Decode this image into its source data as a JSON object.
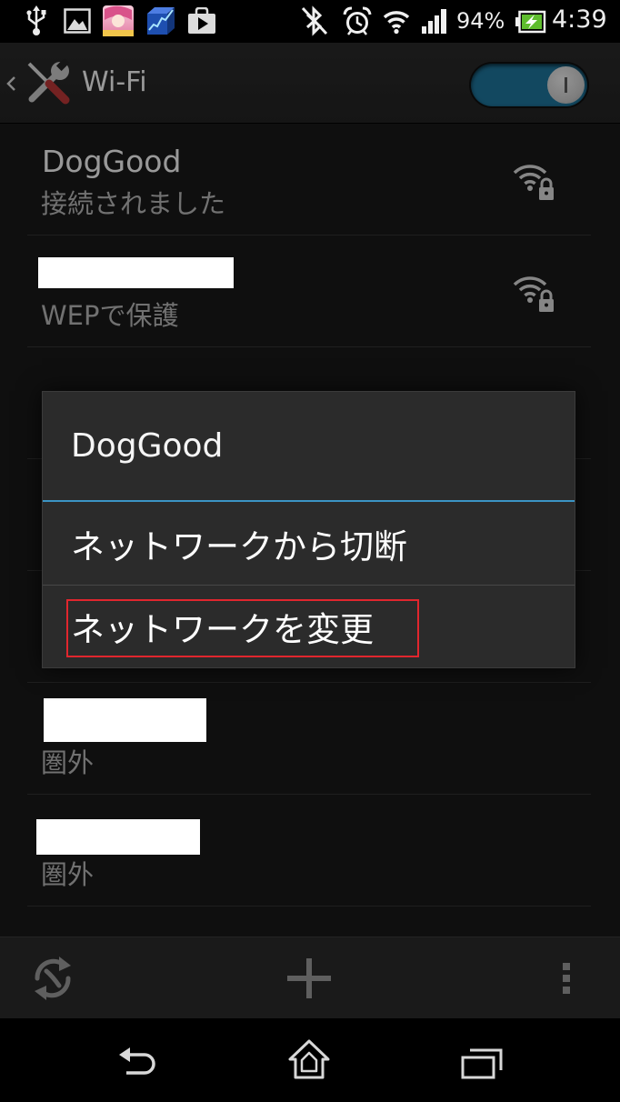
{
  "status_bar": {
    "icons": {
      "usb": "usb-icon",
      "gallery": "gallery-icon",
      "game_app": "game-app-icon",
      "stock_app": "stock-chart-app-icon",
      "play_store": "play-store-icon",
      "bluetooth": "bluetooth-off-icon",
      "alarm": "alarm-clock-icon",
      "wifi": "wifi-signal-icon",
      "cell": "cell-signal-icon",
      "battery": "battery-charging-icon"
    },
    "battery_percent": "94%",
    "time": "4:39"
  },
  "action_bar": {
    "back_icon": "chevron-left-icon",
    "app_icon": "wrench-screwdriver-icon",
    "title": "Wi-Fi",
    "wifi_switch": {
      "on": true
    }
  },
  "network_list": [
    {
      "ssid": "DogGood",
      "status": "接続されました",
      "icon": "wifi-lock-icon"
    },
    {
      "status": "WEPで保護",
      "icon": "wifi-lock-icon"
    },
    {
      "status": "圏外"
    },
    {
      "status": "圏外"
    }
  ],
  "dialog": {
    "title": "DogGood",
    "options": [
      "ネットワークから切断",
      "ネットワークを変更"
    ]
  },
  "bottom_bar": {
    "icons": [
      "wifi-scan-icon",
      "add-network-icon",
      "overflow-menu-icon"
    ]
  },
  "nav_bar": {
    "icons": [
      "back-icon",
      "home-icon",
      "recent-apps-icon"
    ]
  },
  "colors": {
    "accent": "#3b94c4",
    "switch_track": "#1f78a0",
    "annotation_box": "#e1262e"
  }
}
